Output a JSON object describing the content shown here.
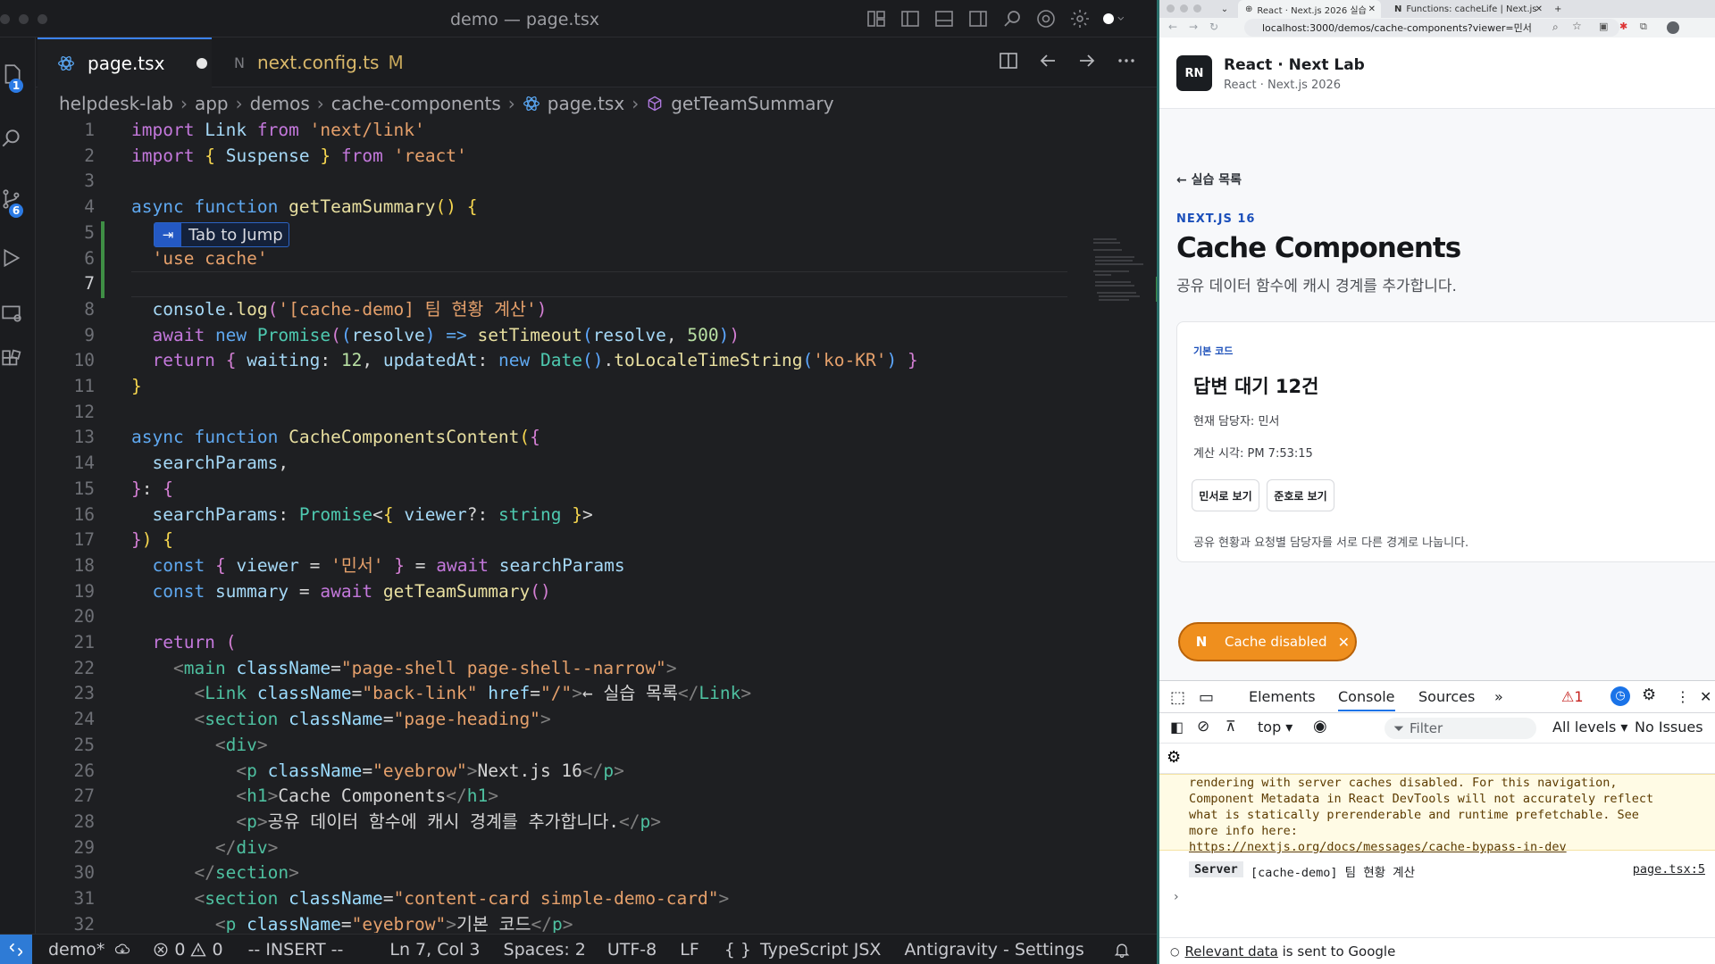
{
  "window": {
    "title": "demo — page.tsx"
  },
  "activity": {
    "explorer_badge": "1",
    "scm_badge": "6"
  },
  "tabs": [
    {
      "label": "page.tsx"
    },
    {
      "label": "next.config.ts",
      "mod": "M"
    }
  ],
  "breadcrumb": [
    "helpdesk-lab",
    "app",
    "demos",
    "cache-components",
    "page.tsx",
    "getTeamSummary"
  ],
  "hint": {
    "key": "⇥",
    "label": "Tab to Jump"
  },
  "status": {
    "branch": "demo*",
    "errors": "0",
    "warnings": "0",
    "mode": "-- INSERT --",
    "position": "Ln 7, Col 3",
    "spaces": "Spaces: 2",
    "encoding": "UTF-8",
    "eol": "LF",
    "language": "TypeScript JSX",
    "extension": "Antigravity - Settings"
  },
  "browser": {
    "tabs": [
      "React · Next.js 2026 실습",
      "Functions: cacheLife | Next.js"
    ],
    "url": "localhost:3000/demos/cache-components?viewer=민서"
  },
  "page": {
    "logo": "RN",
    "app_name": "React · Next Lab",
    "app_sub": "React · Next.js 2026",
    "back": "← 실습 목록",
    "eyebrow": "NEXT.JS 16",
    "title": "Cache Components",
    "lead": "공유 데이터 함수에 캐시 경계를 추가합니다.",
    "card": {
      "eyebrow": "기본 코드",
      "title": "답변 대기 12건",
      "viewer": "현재 담당자: 민서",
      "time": "계산 시각: PM 7:53:15",
      "btn1": "민서로 보기",
      "btn2": "준호로 보기",
      "foot": "공유 현황과 요청별 담당자를 서로 다른 경계로 나눕니다."
    },
    "pill": "Cache disabled"
  },
  "devtools": {
    "tabs": [
      "Elements",
      "Console",
      "Sources"
    ],
    "warnings": "1",
    "context": "top",
    "filter": "Filter",
    "levels": "All levels",
    "issues": "No Issues",
    "warning_lines": [
      "rendering with server caches disabled. For this navigation,",
      "Component Metadata in React DevTools will not accurately reflect",
      "what is statically prerenderable and runtime prefetchable. See",
      "more info here:"
    ],
    "warning_link": "https://nextjs.org/docs/messages/cache-bypass-in-dev",
    "log_badge": "Server",
    "log_text": "[cache-demo] 팀 현황 계산",
    "log_source": "page.tsx:5",
    "footer_link": "Relevant data",
    "footer_text": " is sent to Google"
  }
}
